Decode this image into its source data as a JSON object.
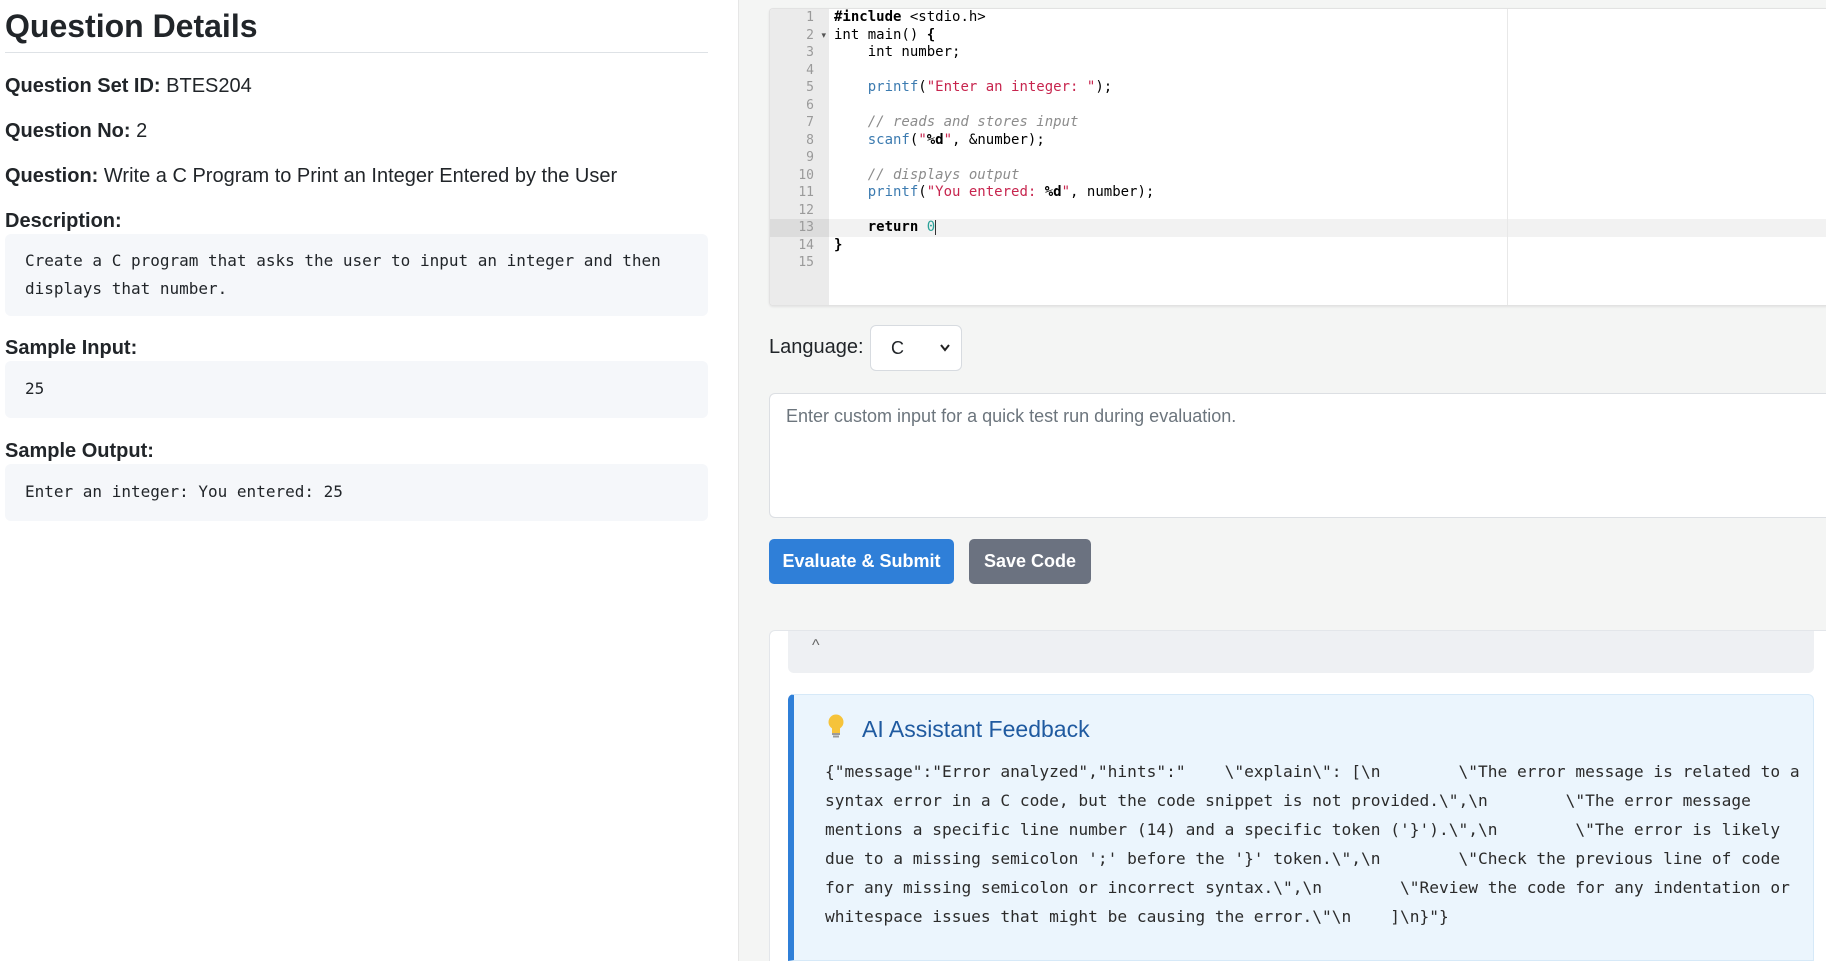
{
  "question": {
    "heading": "Question Details",
    "set_id_label": "Question Set ID:",
    "set_id": "BTES204",
    "no_label": "Question No:",
    "no": "2",
    "question_label": "Question:",
    "question_text": "Write a C Program to Print an Integer Entered by the User",
    "description_label": "Description:",
    "description_text": "Create a C program that asks the user to input an integer and then\ndisplays that number.",
    "sample_input_label": "Sample Input:",
    "sample_input": "25",
    "sample_output_label": "Sample Output:",
    "sample_output": "Enter an integer: You entered: 25"
  },
  "editor": {
    "line_numbers": [
      "1",
      "2",
      "3",
      "4",
      "5",
      "6",
      "7",
      "8",
      "9",
      "10",
      "11",
      "12",
      "13",
      "14",
      "15"
    ],
    "active_line": 13,
    "code_lines": [
      "#include <stdio.h>",
      "int main() {",
      "    int number;",
      "",
      "    printf(\"Enter an integer: \");",
      "",
      "    // reads and stores input",
      "    scanf(\"%d\", &number);",
      "",
      "    // displays output",
      "    printf(\"You entered: %d\", number);",
      "",
      "    return 0",
      "}",
      ""
    ]
  },
  "language": {
    "label": "Language:",
    "selected": "C"
  },
  "custom_input": {
    "placeholder": "Enter custom input for a quick test run during evaluation."
  },
  "buttons": {
    "evaluate": "Evaluate & Submit",
    "save": "Save Code"
  },
  "feedback": {
    "collapse_caret": "^",
    "bulb_icon": "lightbulb-icon",
    "title": "AI Assistant Feedback",
    "body": "{\"message\":\"Error analyzed\",\"hints\":\"    \\\"explain\\\": [\\n        \\\"The error message is related to a syntax error in a C code, but the code snippet is not provided.\\\",\\n        \\\"The error message mentions a specific line number (14) and a specific token ('}').\\\",\\n        \\\"The error is likely due to a missing semicolon ';' before the '}' token.\\\",\\n        \\\"Check the previous line of code for any missing semicolon or incorrect syntax.\\\",\\n        \\\"Review the code for any indentation or whitespace issues that might be causing the error.\\\"\\n    ]\\n}\"}"
  },
  "colors": {
    "primary": "#2f7fd8",
    "secondary": "#6b7280",
    "feedback_bg": "#ebf5fd",
    "feedback_title": "#1f5aa0"
  }
}
